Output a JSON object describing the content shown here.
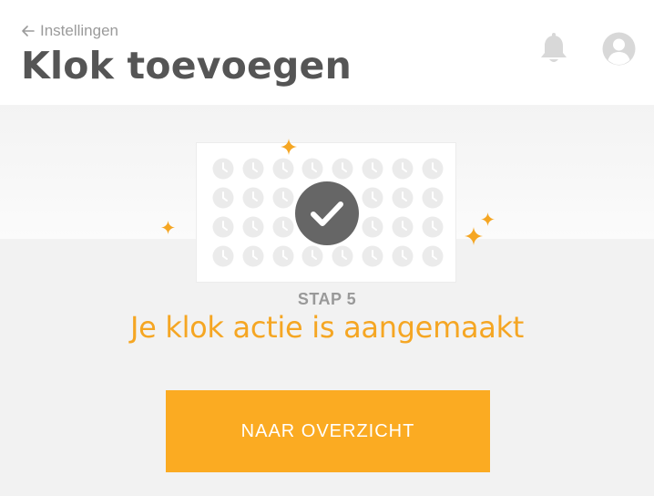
{
  "header": {
    "back_label": "Instellingen",
    "title": "Klok toevoegen",
    "icons": [
      "arrow-left-icon",
      "bell-icon",
      "user-avatar-icon"
    ]
  },
  "illustration": {
    "icons": [
      "clock-icon",
      "checkmark-icon",
      "sparkle-icon"
    ],
    "clock_rows": 4,
    "clock_columns": 8
  },
  "step": {
    "label": "STAP 5",
    "title": "Je klok actie is aangemaakt"
  },
  "actions": {
    "overview_label": "NAAR OVERZICHT"
  },
  "colors": {
    "accent": "#fbab22",
    "title_text": "#555555",
    "muted_text": "#9b9b9b",
    "check_circle": "#666666"
  }
}
